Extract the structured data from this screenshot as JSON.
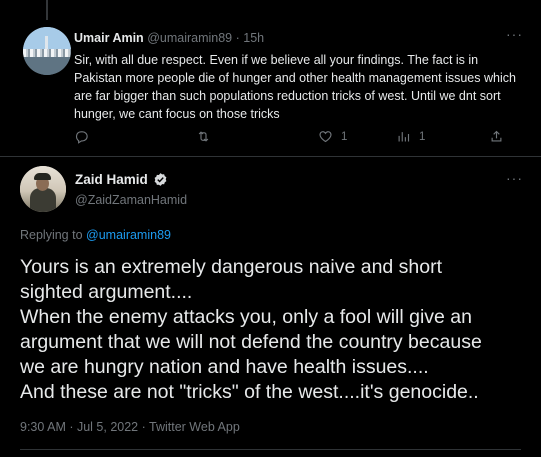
{
  "colors": {
    "background": "#000000",
    "text": "#e7e9ea",
    "muted": "#71767b",
    "accent": "#1d9bf0",
    "border": "#2f3336"
  },
  "reply_tweet": {
    "author_name": "Umair Amin",
    "author_handle": "@umairamin89",
    "separator": "·",
    "time": "15h",
    "text": "Sir, with all due respect. Even if we believe all your findings. The fact is in Pakistan more people die of hunger and other health management issues which are far bigger than such populations reduction tricks of west. Until we dnt sort hunger, we cant focus on those tricks",
    "more_icon": "ellipsis-icon",
    "actions": {
      "reply": {
        "icon": "reply-icon",
        "count": ""
      },
      "retweet": {
        "icon": "retweet-icon",
        "count": ""
      },
      "like": {
        "icon": "heart-icon",
        "count": "1"
      },
      "views": {
        "icon": "bar-chart-icon",
        "count": "1"
      },
      "share": {
        "icon": "share-icon",
        "count": ""
      }
    }
  },
  "main_tweet": {
    "author_name": "Zaid Hamid",
    "author_handle": "@ZaidZamanHamid",
    "verified_icon": "verified-badge-icon",
    "more_icon": "ellipsis-icon",
    "replying_prefix": "Replying to",
    "replying_mention": "@umairamin89",
    "text_lines": [
      "Yours is an extremely dangerous naive and short",
      "sighted argument....",
      "When the enemy attacks you, only a fool will give an",
      "argument that we will not defend the country because",
      "we are hungry nation and have health issues....",
      "And these are not \"tricks\" of the west....it's genocide.."
    ],
    "timestamp": "9:30 AM · Jul 5, 2022 · Twitter Web App"
  }
}
